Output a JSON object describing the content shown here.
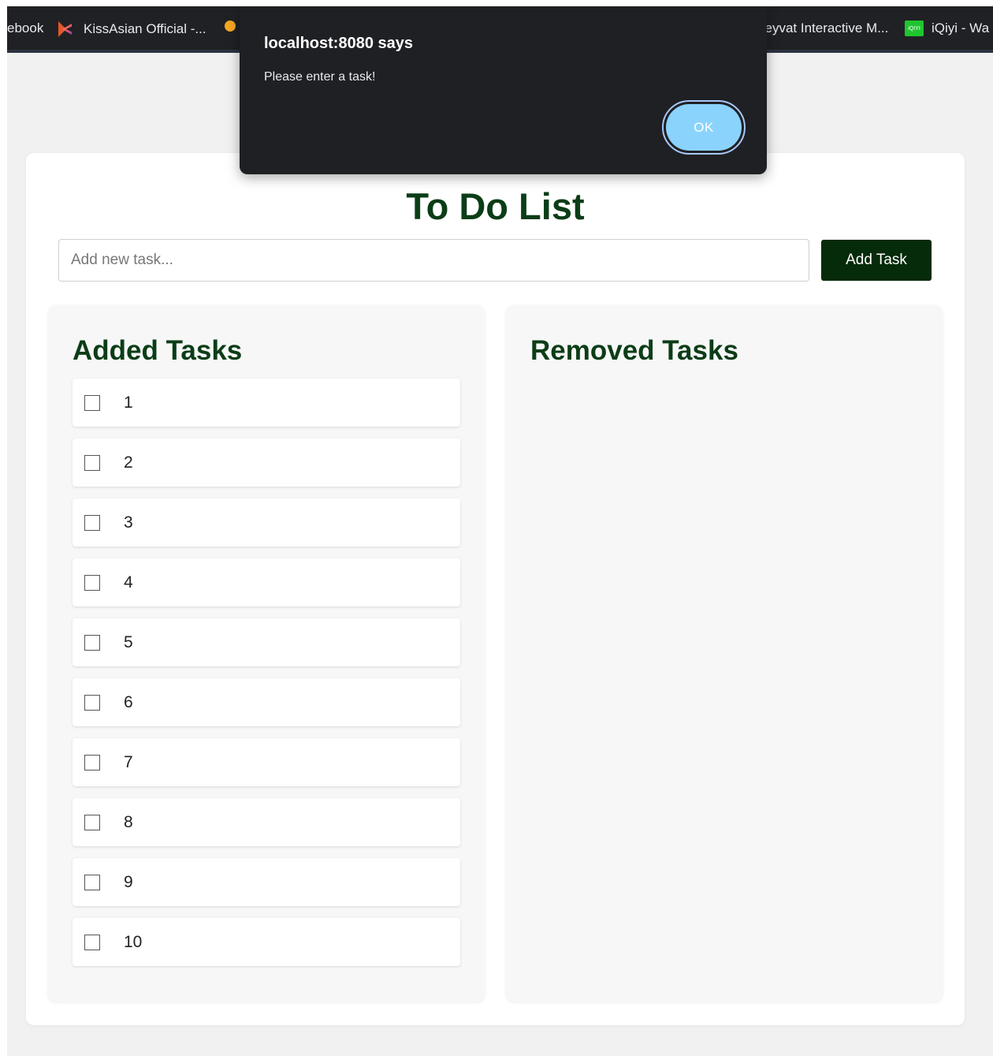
{
  "bookmarks": [
    {
      "label": "ebook",
      "icon": "none"
    },
    {
      "label": "KissAsian Official -...",
      "icon": "kissasian-icon"
    },
    {
      "label": "Teyvat Interactive M...",
      "icon": "none"
    },
    {
      "label": "iQiyi - Wa",
      "icon": "iqiyi-icon",
      "icon_text": "iQIYI"
    }
  ],
  "dialog": {
    "title": "localhost:8080 says",
    "message": "Please enter a task!",
    "ok_label": "OK"
  },
  "app": {
    "title": "To Do List",
    "input_placeholder": "Add new task...",
    "input_value": "",
    "add_button_label": "Add Task",
    "added_heading": "Added Tasks",
    "removed_heading": "Removed Tasks",
    "added_tasks": [
      {
        "text": "1",
        "checked": false
      },
      {
        "text": "2",
        "checked": false
      },
      {
        "text": "3",
        "checked": false
      },
      {
        "text": "4",
        "checked": false
      },
      {
        "text": "5",
        "checked": false
      },
      {
        "text": "6",
        "checked": false
      },
      {
        "text": "7",
        "checked": false
      },
      {
        "text": "8",
        "checked": false
      },
      {
        "text": "9",
        "checked": false
      },
      {
        "text": "10",
        "checked": false
      }
    ],
    "removed_tasks": []
  },
  "colors": {
    "heading_green": "#0b3d17",
    "button_green": "#062b0b",
    "dialog_bg": "#1f2023",
    "ok_button": "#8ad3fc"
  }
}
